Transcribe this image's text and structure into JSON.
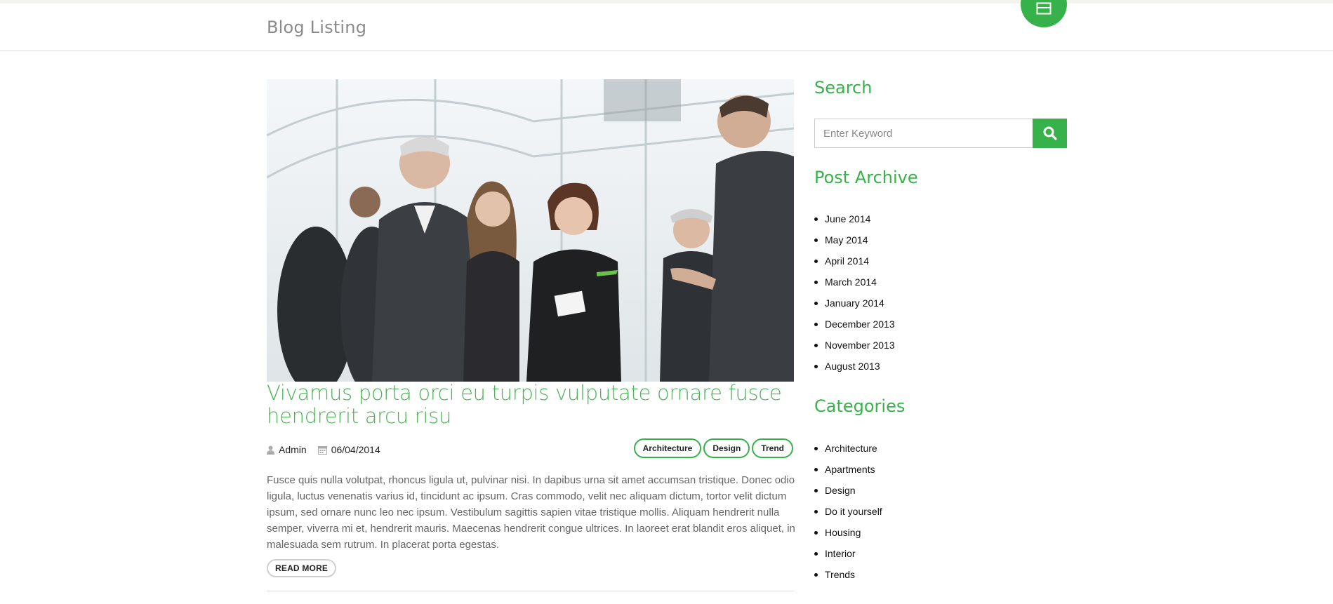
{
  "header": {
    "title": "Blog Listing"
  },
  "post": {
    "title": "Vivamus porta orci eu turpis vulputate ornare fusce hendrerit arcu risu",
    "author": "Admin",
    "date": "06/04/2014",
    "tags": [
      "Architecture",
      "Design",
      "Trend"
    ],
    "excerpt": "Fusce quis nulla volutpat, rhoncus ligula ut, pulvinar nisi. In dapibus urna sit amet accumsan tristique. Donec odio ligula, luctus venenatis varius id, tincidunt ac ipsum. Cras commodo, velit nec aliquam dictum, tortor velit dictum ipsum, sed ornare nunc leo nec ipsum. Vestibulum sagittis sapien vitae tristique mollis. Aliquam hendrerit nulla semper, viverra mi et, hendrerit mauris. Maecenas hendrerit congue ultrices. In laoreet erat blandit eros aliquet, in malesuada sem rutrum. In placerat porta egestas.",
    "read_more": "READ MORE"
  },
  "sidebar": {
    "search_title": "Search",
    "search_placeholder": "Enter Keyword",
    "archive_title": "Post Archive",
    "archive": [
      "June 2014",
      "May 2014",
      "April 2014",
      "March 2014",
      "January 2014",
      "December 2013",
      "November 2013",
      "August 2013"
    ],
    "categories_title": "Categories",
    "categories": [
      "Architecture",
      "Apartments",
      "Design",
      "Do it yourself",
      "Housing",
      "Interior",
      "Trends"
    ]
  },
  "colors": {
    "accent": "#37b24a",
    "title_green": "#4cb356",
    "header_text": "#8a8a8a"
  },
  "icons": {
    "fab": "window-icon",
    "search": "search-icon",
    "author": "user-icon",
    "date": "calendar-icon"
  }
}
